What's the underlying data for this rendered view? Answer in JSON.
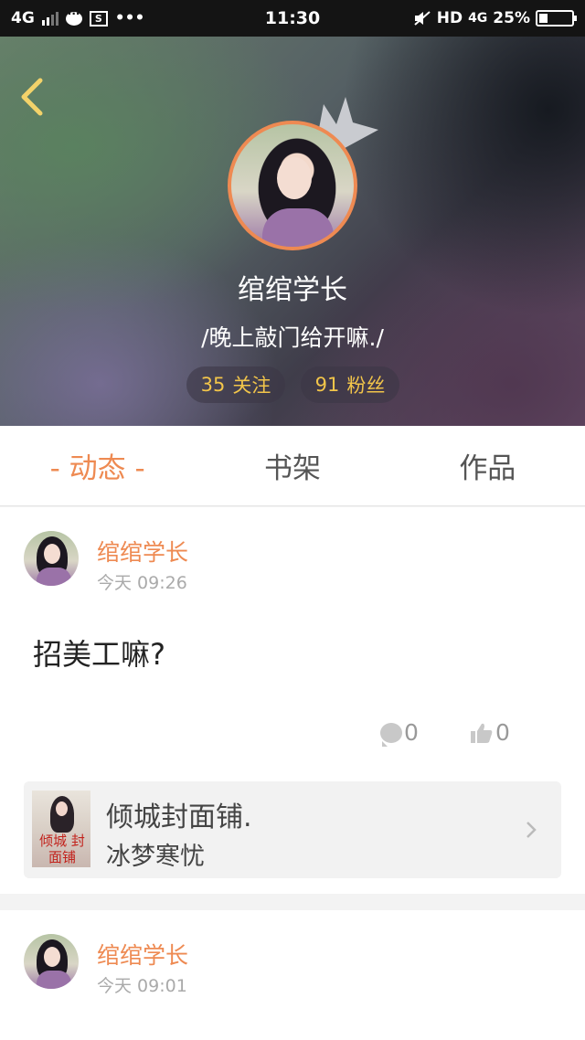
{
  "status_bar": {
    "network": "4G",
    "time": "11:30",
    "hd": "HD",
    "net_right": "4G",
    "battery_text": "25%",
    "battery_level": 0.25,
    "icons": [
      "signal-icon",
      "chat-icon",
      "screenshot-icon",
      "more-dots-icon",
      "mute-icon",
      "battery-icon"
    ]
  },
  "profile": {
    "username": "绾绾学长",
    "bio": "/晚上敲门给开嘛./",
    "follow_count": "35",
    "follow_label": "关注",
    "fans_count": "91",
    "fans_label": "粉丝",
    "accent_color": "#ee8a52",
    "stat_color": "#f2c54a"
  },
  "tabs": [
    {
      "label": "- 动态 -",
      "active": true
    },
    {
      "label": "书架",
      "active": false
    },
    {
      "label": "作品",
      "active": false
    }
  ],
  "posts": [
    {
      "author": "绾绾学长",
      "time": "今天 09:26",
      "text": "招美工嘛?",
      "comments": "0",
      "likes": "0",
      "book": {
        "title": "倾城封面铺.",
        "author": "冰梦寒忧",
        "cover_text": "倾城 封面铺"
      }
    },
    {
      "author": "绾绾学长",
      "time": "今天 09:01"
    }
  ]
}
